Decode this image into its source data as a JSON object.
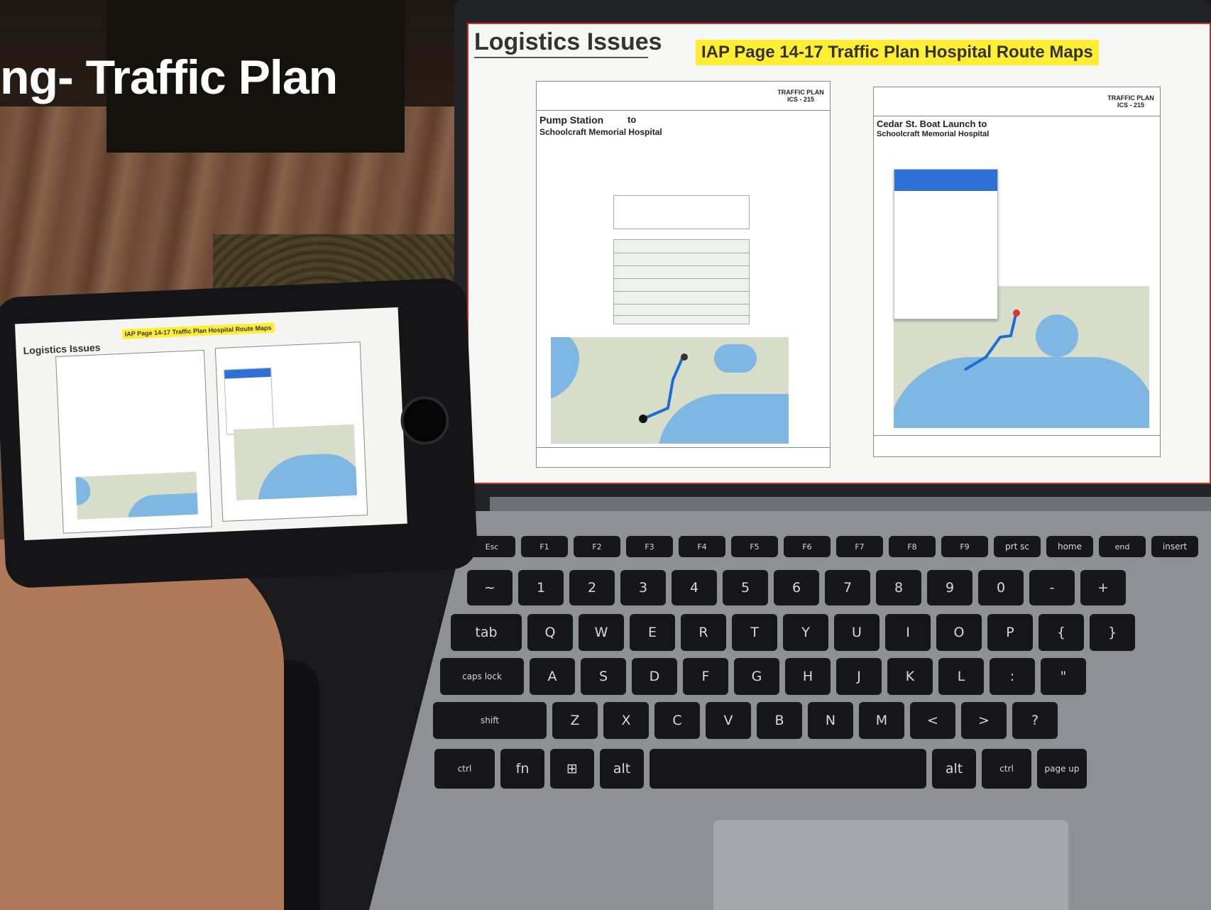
{
  "slide": {
    "title": "ng- Traffic Plan"
  },
  "laptop": {
    "screen_title": "Logistics Issues",
    "banner": "IAP Page 14-17 Traffic Plan Hospital Route Maps",
    "left_doc": {
      "route_from": "Pump Station",
      "route_to_word": "to",
      "route_dest": "Schoolcraft Memorial Hospital",
      "header_right": "TRAFFIC PLAN ICS - 215"
    },
    "right_doc": {
      "route_from": "Cedar St. Boat Launch to",
      "route_dest": "Schoolcraft Memorial Hospital",
      "header_right": "TRAFFIC PLAN ICS - 215"
    }
  },
  "phone": {
    "screen_title": "Logistics Issues",
    "banner": "IAP Page 14-17 Traffic Plan Hospital Route Maps"
  },
  "keyboard": {
    "rows": [
      [
        "Esc",
        "F1",
        "F2",
        "F3",
        "F4",
        "F5",
        "F6",
        "F7",
        "F8",
        "F9",
        "prt sc",
        "home",
        "end",
        "insert"
      ],
      [
        "~",
        "1",
        "2",
        "3",
        "4",
        "5",
        "6",
        "7",
        "8",
        "9",
        "0",
        "-",
        "+"
      ],
      [
        "tab",
        "Q",
        "W",
        "E",
        "R",
        "T",
        "Y",
        "U",
        "I",
        "O",
        "P",
        "{",
        "}"
      ],
      [
        "caps lock",
        "A",
        "S",
        "D",
        "F",
        "G",
        "H",
        "J",
        "K",
        "L",
        ":",
        "\""
      ],
      [
        "shift",
        "Z",
        "X",
        "C",
        "V",
        "B",
        "N",
        "M",
        "<",
        ">",
        "?"
      ],
      [
        "ctrl",
        "fn",
        "⊞",
        "alt",
        "",
        "alt",
        "ctrl",
        "page up"
      ]
    ]
  },
  "colors": {
    "banner": "#ffee33",
    "screen_border": "#c03030",
    "water": "#7fb7e3",
    "route": "#1a6fd6"
  }
}
